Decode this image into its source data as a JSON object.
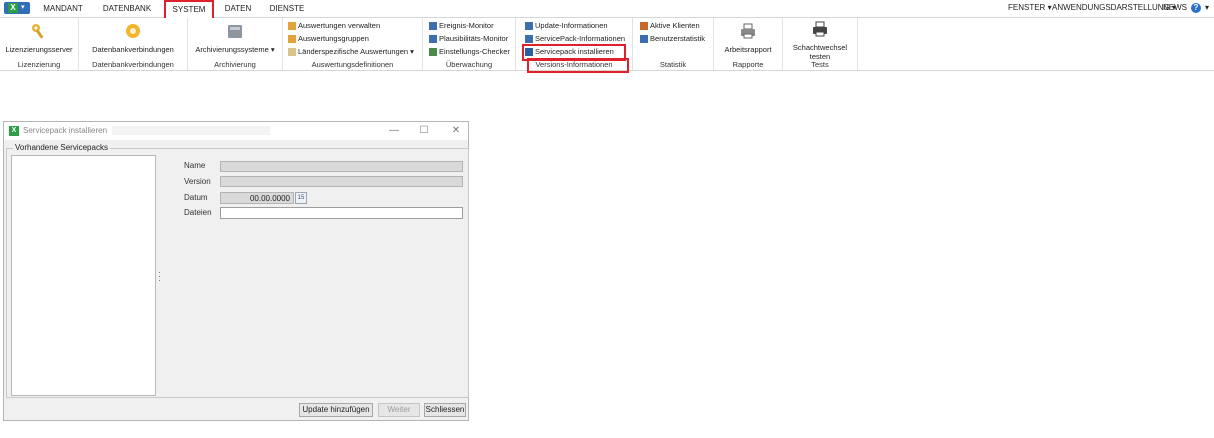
{
  "tabs": [
    {
      "label": "MANDANT"
    },
    {
      "label": "DATENBANK"
    },
    {
      "label": "SYSTEM"
    },
    {
      "label": "DATEN"
    },
    {
      "label": "DIENSTE"
    }
  ],
  "right_menu": {
    "fenster": "FENSTER",
    "anwendungsdarstellung": "ANWENDUNGSDARSTELLUNG",
    "news": "NEWS",
    "help": "?"
  },
  "ribbon": {
    "lizenzierung": {
      "button": "Lizenzierungsserver",
      "label": "Lizenzierung"
    },
    "datenbankverbindungen": {
      "button": "Datenbankverbindungen",
      "label": "Datenbankverbindungen"
    },
    "archivierung": {
      "button": "Archivierungssysteme",
      "label": "Archivierung"
    },
    "auswertungsdefinitionen": {
      "items": [
        "Auswertungen verwalten",
        "Auswertungsgruppen",
        "Länderspezifische Auswertungen"
      ],
      "label": "Auswertungsdefinitionen"
    },
    "ueberwachung": {
      "items": [
        "Ereignis-Monitor",
        "Plausibilitäts-Monitor",
        "Einstellungs-Checker"
      ],
      "label": "Überwachung"
    },
    "versions": {
      "items": [
        "Update-Informationen",
        "ServicePack-Informationen",
        "Servicepack installieren"
      ],
      "label": "Versions-Informationen"
    },
    "statistik": {
      "items": [
        "Aktive Klienten",
        "Benutzerstatistik"
      ],
      "label": "Statistik"
    },
    "rapporte": {
      "button": "Arbeitsrapport",
      "label": "Rapporte"
    },
    "tests": {
      "button_line1": "Schachtwechsel",
      "button_line2": "testen",
      "label": "Tests"
    }
  },
  "dialog": {
    "title": "Servicepack installieren",
    "group_title": "Vorhandene Servicepacks",
    "fields": {
      "name_label": "Name",
      "version_label": "Version",
      "datum_label": "Datum",
      "datum_value": "00.00.0000",
      "calendar_day": "15",
      "dateien_label": "Dateien"
    },
    "buttons": {
      "update": "Update hinzufügen",
      "weiter": "Weiter",
      "schliessen": "Schliessen"
    }
  }
}
